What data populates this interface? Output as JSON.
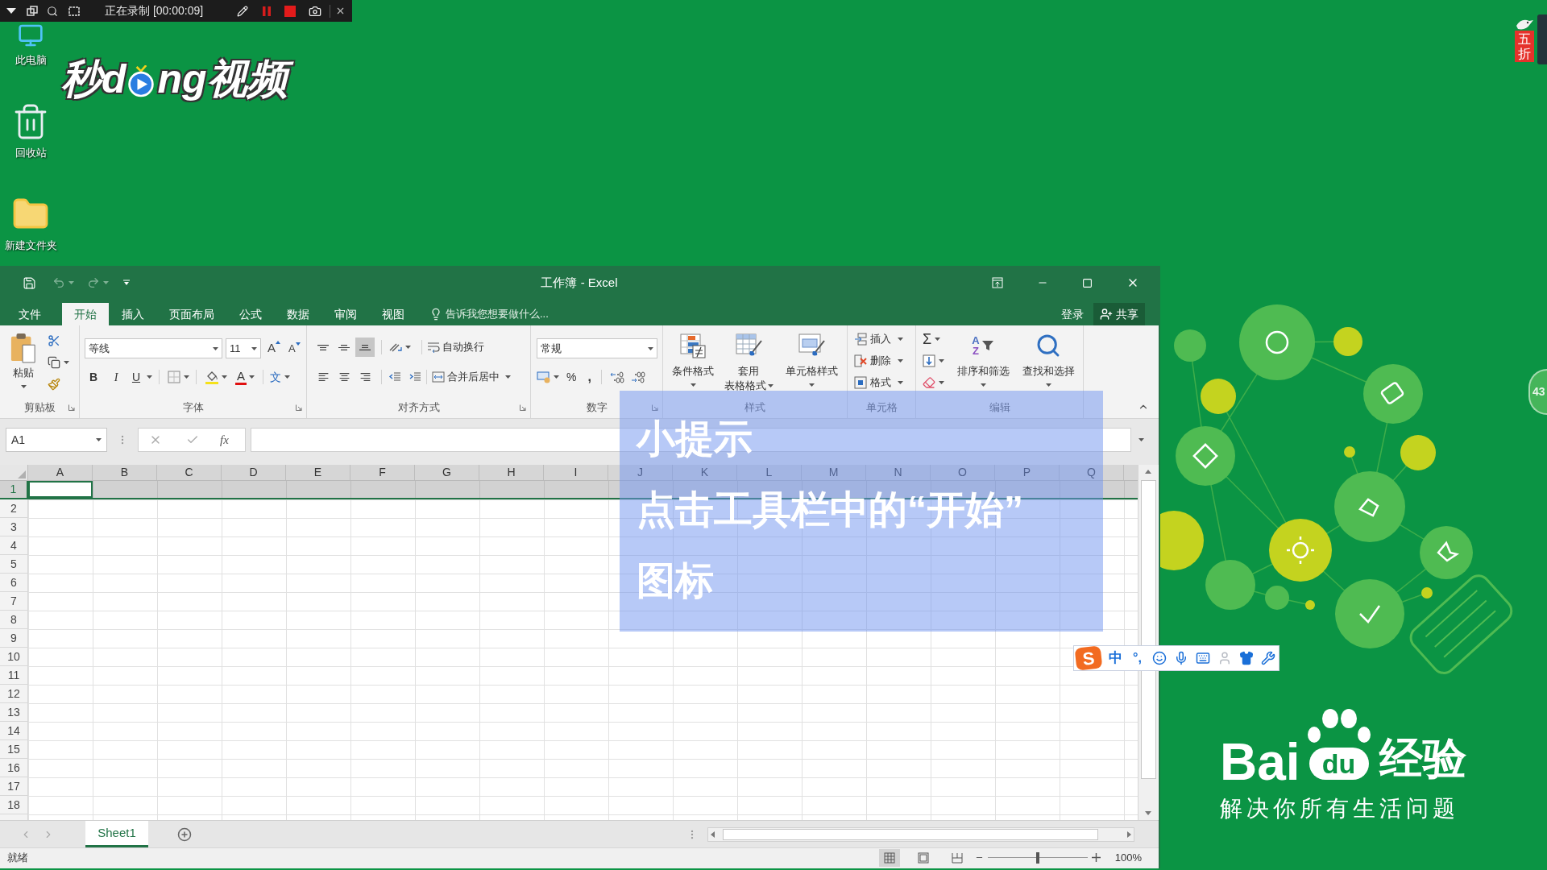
{
  "recorder_bar": {
    "status": "正在录制 [00:00:09]"
  },
  "desktop_icons": [
    {
      "label": "此电脑",
      "kind": "computer"
    },
    {
      "label": "回收站",
      "kind": "recycle-bin"
    },
    {
      "label": "新建文件夹",
      "kind": "folder"
    }
  ],
  "video_logo": {
    "before": "秒d",
    "after": "ng视频"
  },
  "promo_tag": {
    "text": "五折"
  },
  "edge_badge": {
    "text": "43"
  },
  "excel": {
    "title": "工作簿 - Excel",
    "tabs": [
      {
        "label": "文件",
        "selected": false
      },
      {
        "label": "开始",
        "selected": true
      },
      {
        "label": "插入",
        "selected": false
      },
      {
        "label": "页面布局",
        "selected": false
      },
      {
        "label": "公式",
        "selected": false
      },
      {
        "label": "数据",
        "selected": false
      },
      {
        "label": "审阅",
        "selected": false
      },
      {
        "label": "视图",
        "selected": false
      }
    ],
    "tell_me": "告诉我您想要做什么...",
    "sign_in": "登录",
    "share": "共享",
    "clipboard": {
      "paste": "粘贴",
      "group": "剪贴板"
    },
    "font": {
      "name": "等线",
      "size": "11",
      "grow": "A",
      "shrink": "A",
      "bold": "B",
      "italic": "I",
      "underline": "U",
      "color_letter": "A",
      "phonetic": "文",
      "group": "字体"
    },
    "alignment": {
      "vertical": [
        {
          "kind": "top",
          "selected": false
        },
        {
          "kind": "middle",
          "selected": false
        },
        {
          "kind": "bottom",
          "selected": true
        }
      ],
      "wrap": "自动换行",
      "merge": "合并后居中",
      "group": "对齐方式"
    },
    "number": {
      "format": "常规",
      "percent": "%",
      "comma": ",",
      "group": "数字"
    },
    "styles": {
      "conditional": "条件格式",
      "table": [
        "套用",
        "表格格式"
      ],
      "cell": "单元格样式",
      "group": "样式"
    },
    "cells": {
      "items": [
        "插入",
        "删除",
        "格式"
      ],
      "group": "单元格"
    },
    "editing": {
      "sum": "Σ",
      "sort_letters": [
        "A",
        "Z"
      ],
      "sort": "排序和筛选",
      "find": "查找和选择",
      "group": "编辑"
    },
    "name_box": "A1",
    "fx": "fx",
    "columns": [
      "A",
      "B",
      "C",
      "D",
      "E",
      "F",
      "G",
      "H",
      "I",
      "J",
      "K",
      "L",
      "M",
      "N",
      "O",
      "P",
      "Q"
    ],
    "rows": [
      {
        "label": "1",
        "selected": true
      },
      {
        "label": "2",
        "selected": false
      },
      {
        "label": "3",
        "selected": false
      },
      {
        "label": "4",
        "selected": false
      },
      {
        "label": "5",
        "selected": false
      },
      {
        "label": "6",
        "selected": false
      },
      {
        "label": "7",
        "selected": false
      },
      {
        "label": "8",
        "selected": false
      },
      {
        "label": "9",
        "selected": false
      },
      {
        "label": "10",
        "selected": false
      },
      {
        "label": "11",
        "selected": false
      },
      {
        "label": "12",
        "selected": false
      },
      {
        "label": "13",
        "selected": false
      },
      {
        "label": "14",
        "selected": false
      },
      {
        "label": "15",
        "selected": false
      },
      {
        "label": "16",
        "selected": false
      },
      {
        "label": "17",
        "selected": false
      },
      {
        "label": "18",
        "selected": false
      }
    ],
    "sheet_tabs": [
      {
        "label": "Sheet1",
        "selected": true
      }
    ],
    "status": "就绪",
    "views": [
      {
        "kind": "normal",
        "selected": true
      },
      {
        "kind": "page-layout",
        "selected": false
      },
      {
        "kind": "page-break",
        "selected": false
      }
    ],
    "zoom": {
      "level": 0.5,
      "reading": "100%"
    }
  },
  "tip_overlay": {
    "title": "小提示",
    "lines": [
      "点击工具栏中的“开始”",
      "图标"
    ]
  },
  "ime_toolbar": {
    "logo": "S",
    "mode": "中",
    "punctuation": "°,"
  },
  "brand": {
    "bai": "Bai",
    "du": "du",
    "jingyan": "经验",
    "slogan": "解决你所有生活问题"
  }
}
